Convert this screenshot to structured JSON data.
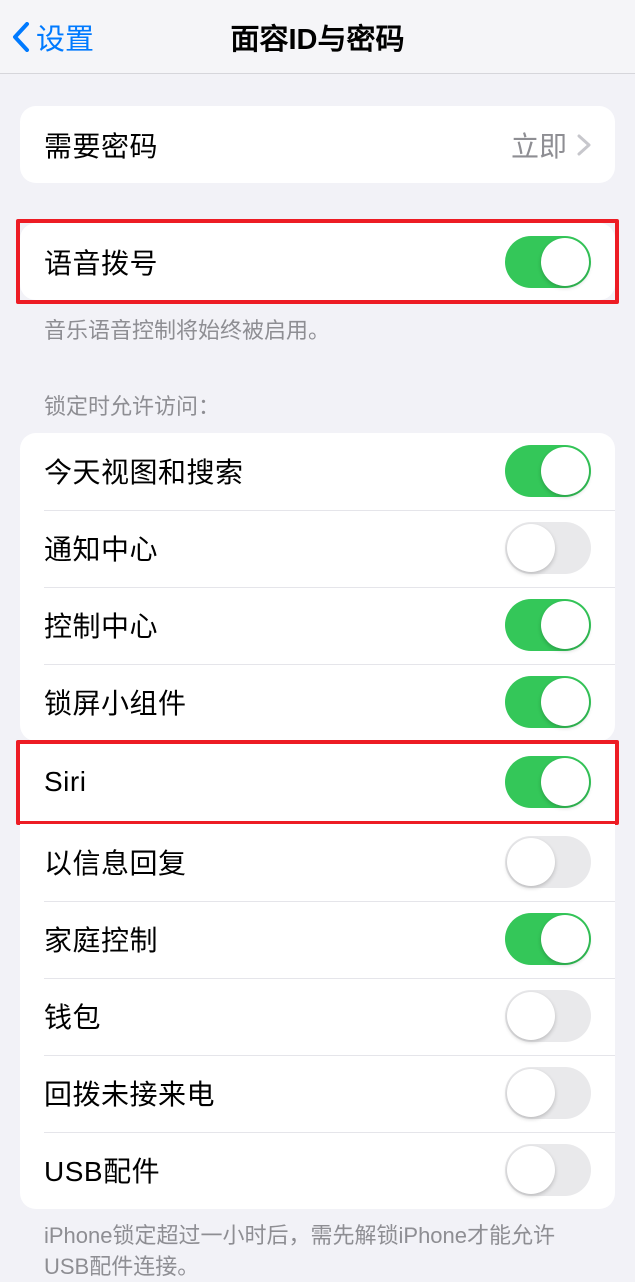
{
  "nav": {
    "back": "设置",
    "title": "面容ID与密码"
  },
  "section_passcode": {
    "require_label": "需要密码",
    "require_value": "立即"
  },
  "section_voice": {
    "voice_dial_label": "语音拨号",
    "footer": "音乐语音控制将始终被启用。"
  },
  "section_lock": {
    "header": "锁定时允许访问：",
    "items": {
      "today": "今天视图和搜索",
      "notification_center": "通知中心",
      "control_center": "控制中心",
      "lock_widgets": "锁屏小组件",
      "siri": "Siri",
      "reply_message": "以信息回复",
      "home_control": "家庭控制",
      "wallet": "钱包",
      "return_missed": "回拨未接来电",
      "usb": "USB配件"
    },
    "toggles": {
      "today": true,
      "notification_center": false,
      "control_center": true,
      "lock_widgets": true,
      "siri": true,
      "reply_message": false,
      "home_control": true,
      "wallet": false,
      "return_missed": false,
      "usb": false
    },
    "footer": "iPhone锁定超过一小时后，需先解锁iPhone才能允许USB配件连接。"
  }
}
